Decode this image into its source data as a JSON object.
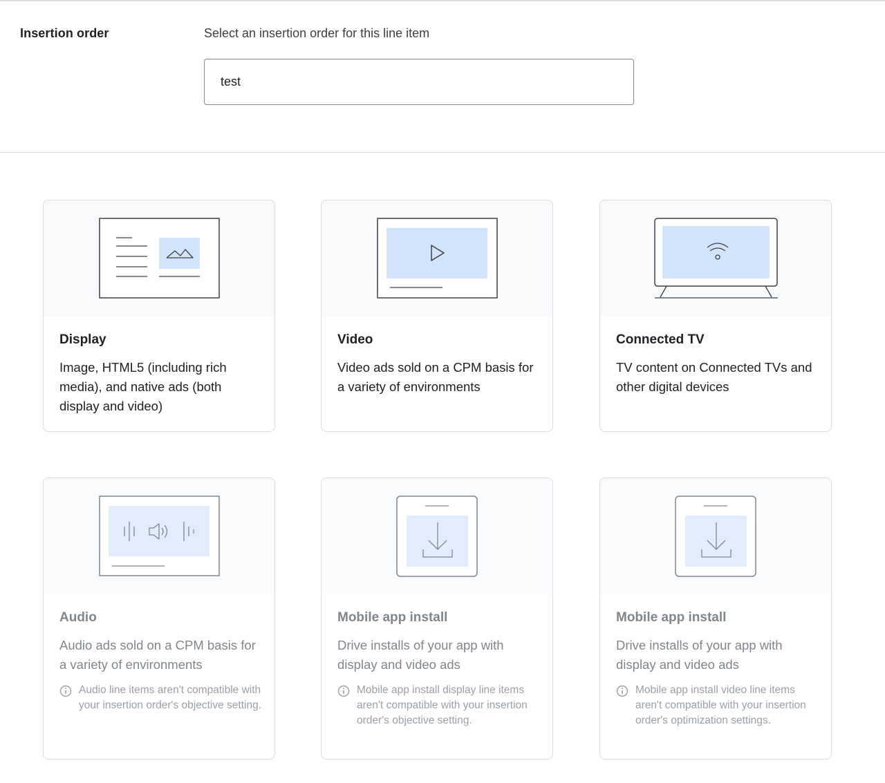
{
  "insertion_order": {
    "label": "Insertion order",
    "prompt": "Select an insertion order for this line item",
    "value": "test"
  },
  "cards": [
    {
      "title": "Display",
      "description": "Image, HTML5 (including rich media), and native ads (both display and video)",
      "note": ""
    },
    {
      "title": "Video",
      "description": "Video ads sold on a CPM basis for a variety of environments",
      "note": ""
    },
    {
      "title": "Connected TV",
      "description": "TV content on Connected TVs and other digital devices",
      "note": ""
    },
    {
      "title": "Audio",
      "description": "Audio ads sold on a CPM basis for a variety of environments",
      "note": "Audio line items aren't compatible with your insertion order's objective setting."
    },
    {
      "title": "Mobile app install",
      "description": "Drive installs of your app with display and video ads",
      "note": "Mobile app install display line items aren't compatible with your insertion order's objective setting."
    },
    {
      "title": "Mobile app install",
      "description": "Drive installs of your app with display and video ads",
      "note": "Mobile app install video line items aren't compatible with your insertion order's optimization settings."
    }
  ],
  "colors": {
    "illustration_fill": "#d2e3fc",
    "line": "#3c4043",
    "disabled_text": "#80868b"
  }
}
